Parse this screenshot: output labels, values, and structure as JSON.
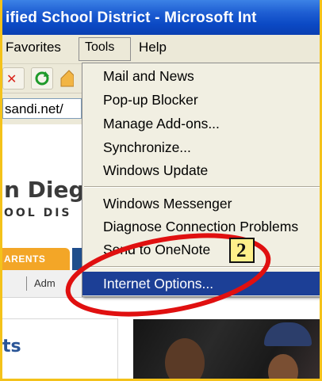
{
  "window": {
    "title": "ified School District - Microsoft Int"
  },
  "menubar": {
    "favorites": "Favorites",
    "tools": "Tools",
    "help": "Help"
  },
  "address": {
    "value": "sandi.net/"
  },
  "page": {
    "logo_line1": "n Dieg",
    "logo_line2": "OOL DIS",
    "tab_parents": "ARENTS",
    "subnav_item": "Adm",
    "heading": "ts"
  },
  "tools_menu": {
    "items": [
      "Mail and News",
      "Pop-up Blocker",
      "Manage Add-ons...",
      "Synchronize...",
      "Windows Update",
      "Windows Messenger",
      "Diagnose Connection Problems",
      "Send to OneNote"
    ],
    "highlighted": "Internet Options..."
  },
  "annotation": {
    "step": "2"
  },
  "colors": {
    "highlight": "#1c3f96",
    "callout_ring": "#e01010",
    "callout_box": "#fef08a"
  }
}
